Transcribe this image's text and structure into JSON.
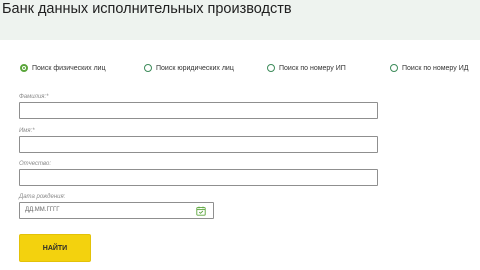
{
  "page": {
    "title": "Банк данных исполнительных производств"
  },
  "search_modes": [
    {
      "label": "Поиск физических лиц",
      "selected": true
    },
    {
      "label": "Поиск юридических лиц",
      "selected": false
    },
    {
      "label": "Поиск по номеру ИП",
      "selected": false
    },
    {
      "label": "Поиск по номеру ИД",
      "selected": false
    }
  ],
  "form": {
    "lastname_label": "Фамилия:*",
    "firstname_label": "Имя:*",
    "patronymic_label": "Отчество:",
    "birthdate_label": "Дата рождения:",
    "birthdate_placeholder": "ДД.ММ.ГГГГ",
    "submit_label": "НАЙТИ"
  },
  "colors": {
    "accent_green": "#5aa53b",
    "button_yellow": "#f3d20e",
    "header_bg": "#eef3ef"
  },
  "icons": {
    "date_picker": "calendar-icon"
  }
}
